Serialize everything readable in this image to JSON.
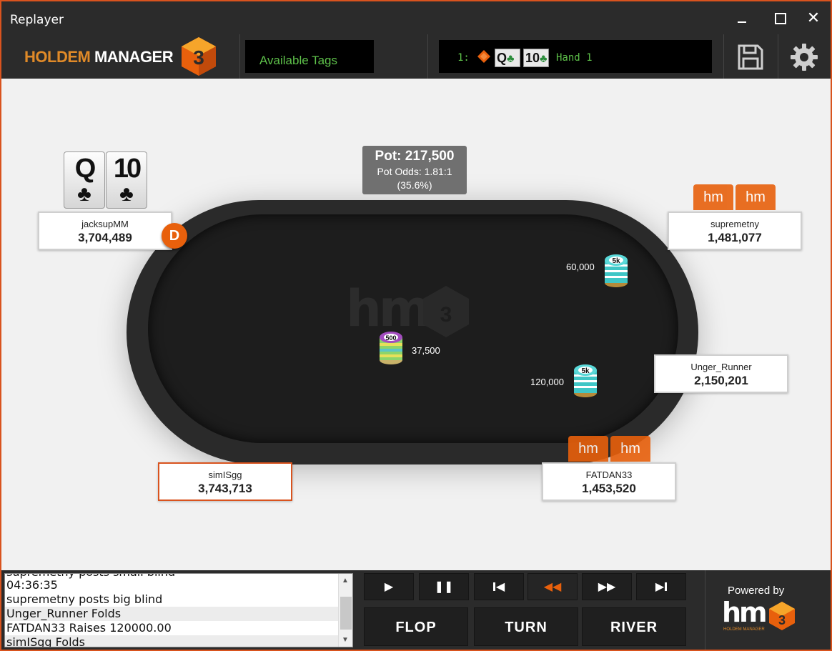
{
  "window": {
    "title": "Replayer"
  },
  "toolbar": {
    "logo_text_a": "HOLDEM",
    "logo_text_b": "MANAGER",
    "logo_hex_label": "3",
    "tags_label": "Available Tags",
    "hand_num": "1:",
    "hand_cards": [
      {
        "rank": "Q",
        "suit": "♣"
      },
      {
        "rank": "10",
        "suit": "♣"
      }
    ],
    "hand_label": "Hand 1"
  },
  "pot": {
    "amount": "Pot: 217,500",
    "odds": "Pot Odds: 1.81:1",
    "pct": "(35.6%)"
  },
  "table_logo": {
    "text": "hm",
    "badge": "3"
  },
  "hero_cards": [
    {
      "rank": "Q",
      "suit": "♣"
    },
    {
      "rank": "10",
      "suit": "♣"
    }
  ],
  "hm_tag": "hm",
  "dealer_button": "D",
  "players": [
    {
      "name": "jacksupMM",
      "stack": "3,704,489"
    },
    {
      "name": "supremetny",
      "stack": "1,481,077"
    },
    {
      "name": "Unger_Runner",
      "stack": "2,150,201"
    },
    {
      "name": "FATDAN33",
      "stack": "1,453,520"
    },
    {
      "name": "simISgg",
      "stack": "3,743,713"
    }
  ],
  "bets": [
    {
      "amount": "60,000",
      "chip": "5k"
    },
    {
      "amount": "120,000",
      "chip": "5k"
    },
    {
      "amount": "37,500",
      "chip": "500"
    }
  ],
  "log": {
    "partial_top": "supremetny posts small blind",
    "lines": [
      "04:36:35",
      "supremetny posts big blind",
      "Unger_Runner Folds",
      "FATDAN33 Raises 120000.00",
      "simISgg Folds"
    ]
  },
  "controls": {
    "play": "▶",
    "pause": "❚❚",
    "first": "◀",
    "rewind": "◀◀",
    "forward": "▶▶",
    "last": "▶"
  },
  "streets": {
    "flop": "FLOP",
    "turn": "TURN",
    "river": "RIVER"
  },
  "powered_by": {
    "label": "Powered by",
    "brand": "hm",
    "badge": "3",
    "sub": "HOLDEM MANAGER"
  },
  "colors": {
    "accent": "#e8600c",
    "tag_green": "#5ec14a",
    "border": "#d9531e"
  }
}
